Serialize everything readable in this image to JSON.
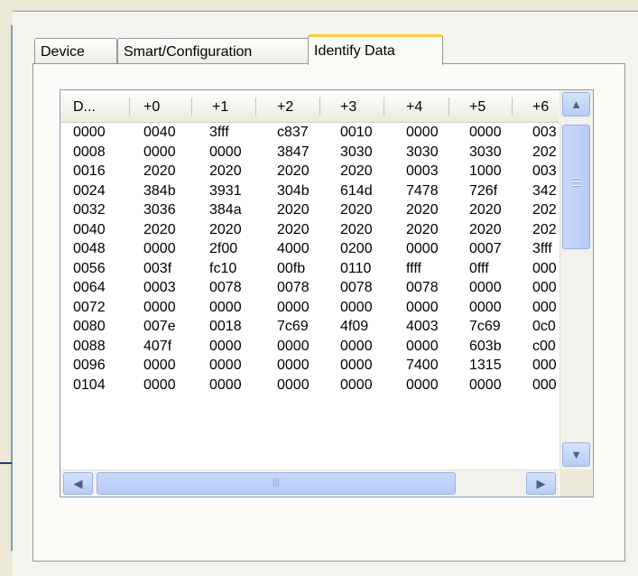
{
  "tabs": [
    {
      "label": "Device",
      "active": false
    },
    {
      "label": "Smart/Configuration",
      "active": false
    },
    {
      "label": "Identify Data",
      "active": true
    }
  ],
  "table": {
    "columns": [
      "D...",
      "+0",
      "+1",
      "+2",
      "+3",
      "+4",
      "+5",
      "+6"
    ],
    "rows": [
      [
        "0000",
        "0040",
        "3fff",
        "c837",
        "0010",
        "0000",
        "0000",
        "003"
      ],
      [
        "0008",
        "0000",
        "0000",
        "3847",
        "3030",
        "3030",
        "3030",
        "202"
      ],
      [
        "0016",
        "2020",
        "2020",
        "2020",
        "2020",
        "0003",
        "1000",
        "003"
      ],
      [
        "0024",
        "384b",
        "3931",
        "304b",
        "614d",
        "7478",
        "726f",
        "342"
      ],
      [
        "0032",
        "3036",
        "384a",
        "2020",
        "2020",
        "2020",
        "2020",
        "202"
      ],
      [
        "0040",
        "2020",
        "2020",
        "2020",
        "2020",
        "2020",
        "2020",
        "202"
      ],
      [
        "0048",
        "0000",
        "2f00",
        "4000",
        "0200",
        "0000",
        "0007",
        "3fff"
      ],
      [
        "0056",
        "003f",
        "fc10",
        "00fb",
        "0110",
        "ffff",
        "0fff",
        "000"
      ],
      [
        "0064",
        "0003",
        "0078",
        "0078",
        "0078",
        "0078",
        "0000",
        "000"
      ],
      [
        "0072",
        "0000",
        "0000",
        "0000",
        "0000",
        "0000",
        "0000",
        "000"
      ],
      [
        "0080",
        "007e",
        "0018",
        "7c69",
        "4f09",
        "4003",
        "7c69",
        "0c0"
      ],
      [
        "0088",
        "407f",
        "0000",
        "0000",
        "0000",
        "0000",
        "603b",
        "c00"
      ],
      [
        "0096",
        "0000",
        "0000",
        "0000",
        "0000",
        "7400",
        "1315",
        "000"
      ],
      [
        "0104",
        "0000",
        "0000",
        "0000",
        "0000",
        "0000",
        "0000",
        "000"
      ]
    ]
  },
  "scrollbars": {
    "up_icon": "arrow-up-icon",
    "down_icon": "arrow-down-icon",
    "left_icon": "arrow-left-icon",
    "right_icon": "arrow-right-icon"
  },
  "colors": {
    "window_bg": "#ECE9D8",
    "active_tab_accent": "#FFC83C",
    "scrollbar_blue": "#B8CCF5"
  }
}
